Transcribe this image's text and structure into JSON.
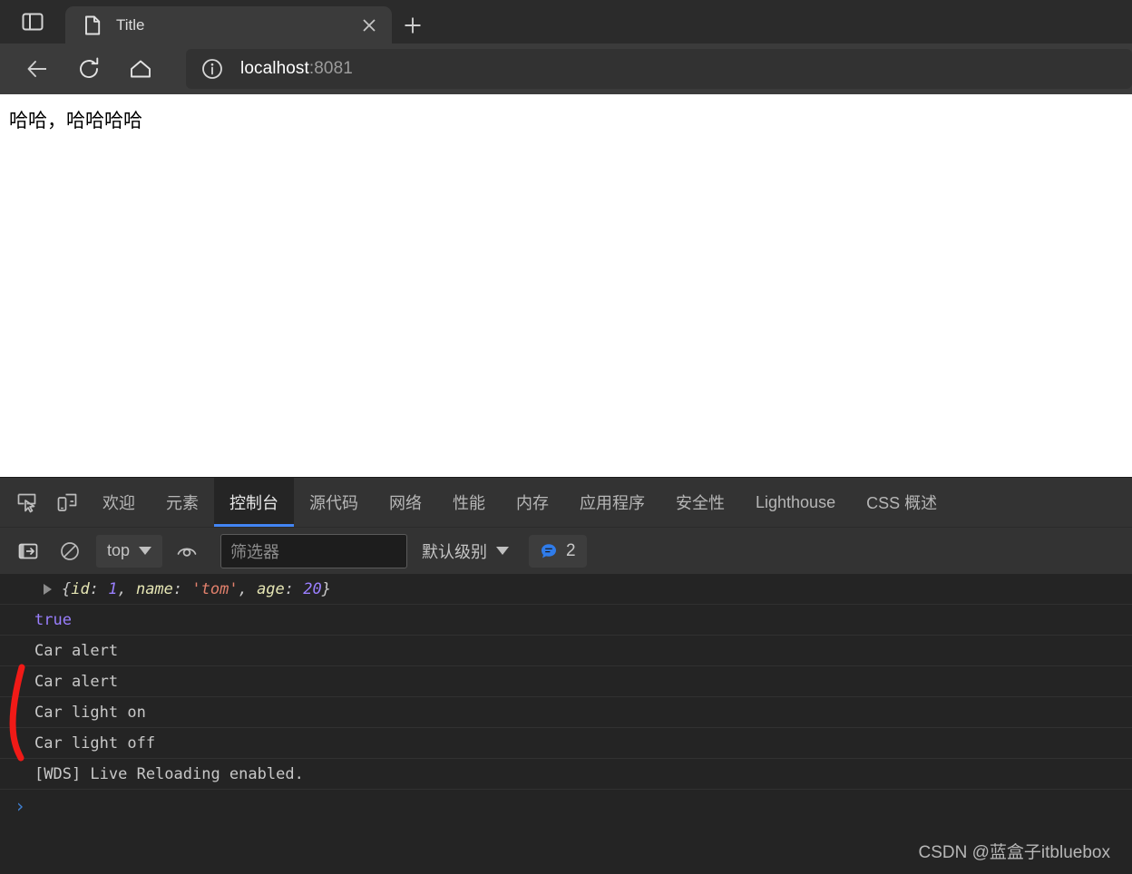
{
  "browser": {
    "sidebar_icon": "sidebar-panel-icon",
    "tab": {
      "favicon": "document-page-icon",
      "title": "Title",
      "close_icon": "close-icon"
    },
    "new_tab_icon": "plus-icon",
    "nav": {
      "back_icon": "arrow-left-icon",
      "reload_icon": "reload-icon",
      "home_icon": "home-icon"
    },
    "omnibox": {
      "info_icon": "info-circle-icon",
      "host": "localhost",
      "port": ":8081"
    }
  },
  "page": {
    "text": "哈哈，哈哈哈哈"
  },
  "devtools": {
    "tool_icons": [
      {
        "name": "inspect-element-icon"
      },
      {
        "name": "device-toolbar-icon"
      }
    ],
    "tabs": [
      {
        "label": "欢迎",
        "key": "welcome",
        "selected": false
      },
      {
        "label": "元素",
        "key": "elements",
        "selected": false
      },
      {
        "label": "控制台",
        "key": "console",
        "selected": true
      },
      {
        "label": "源代码",
        "key": "sources",
        "selected": false
      },
      {
        "label": "网络",
        "key": "network",
        "selected": false
      },
      {
        "label": "性能",
        "key": "performance",
        "selected": false
      },
      {
        "label": "内存",
        "key": "memory",
        "selected": false
      },
      {
        "label": "应用程序",
        "key": "application",
        "selected": false
      },
      {
        "label": "安全性",
        "key": "security",
        "selected": false
      },
      {
        "label": "Lighthouse",
        "key": "lighthouse",
        "selected": false
      },
      {
        "label": "CSS 概述",
        "key": "css-overview",
        "selected": false
      }
    ],
    "console_toolbar": {
      "sidebar_toggle_icon": "console-sidebar-toggle-icon",
      "clear_icon": "clear-console-icon",
      "context_value": "top",
      "eye_icon": "live-expression-eye-icon",
      "filter_placeholder": "筛选器",
      "filter_value": "",
      "levels_label": "默认级别",
      "message_badge": {
        "icon": "message-bubble-icon",
        "count": "2"
      }
    },
    "console_rows": [
      {
        "kind": "object",
        "expandable": true,
        "tokens": [
          {
            "t": "{",
            "c": "tok-punct"
          },
          {
            "t": "id",
            "c": "tok-key"
          },
          {
            "t": ": ",
            "c": "tok-punct"
          },
          {
            "t": "1",
            "c": "tok-num"
          },
          {
            "t": ", ",
            "c": "tok-punct"
          },
          {
            "t": "name",
            "c": "tok-key"
          },
          {
            "t": ": ",
            "c": "tok-punct"
          },
          {
            "t": "'tom'",
            "c": "tok-str"
          },
          {
            "t": ", ",
            "c": "tok-punct"
          },
          {
            "t": "age",
            "c": "tok-key"
          },
          {
            "t": ": ",
            "c": "tok-punct"
          },
          {
            "t": "20",
            "c": "tok-num"
          },
          {
            "t": "}",
            "c": "tok-punct"
          }
        ],
        "plain": "{id: 1, name: 'tom', age: 20}"
      },
      {
        "kind": "bool",
        "text": "true"
      },
      {
        "kind": "log",
        "text": "Car alert"
      },
      {
        "kind": "log",
        "text": "Car alert"
      },
      {
        "kind": "log",
        "text": "Car light on"
      },
      {
        "kind": "log",
        "text": "Car light off"
      },
      {
        "kind": "log",
        "text": "[WDS] Live Reloading enabled."
      }
    ],
    "prompt_chevron": "›"
  },
  "annotation": {
    "name": "red-bracket-annotation",
    "color": "#f01a17"
  },
  "watermark": {
    "text": "CSDN @蓝盒子itbluebox"
  },
  "colors": {
    "accent": "#4285f4",
    "chrome_bg": "#3b3b3b",
    "devtools_bg": "#282828",
    "console_bg": "#242424",
    "annotation_red": "#f01a17"
  }
}
